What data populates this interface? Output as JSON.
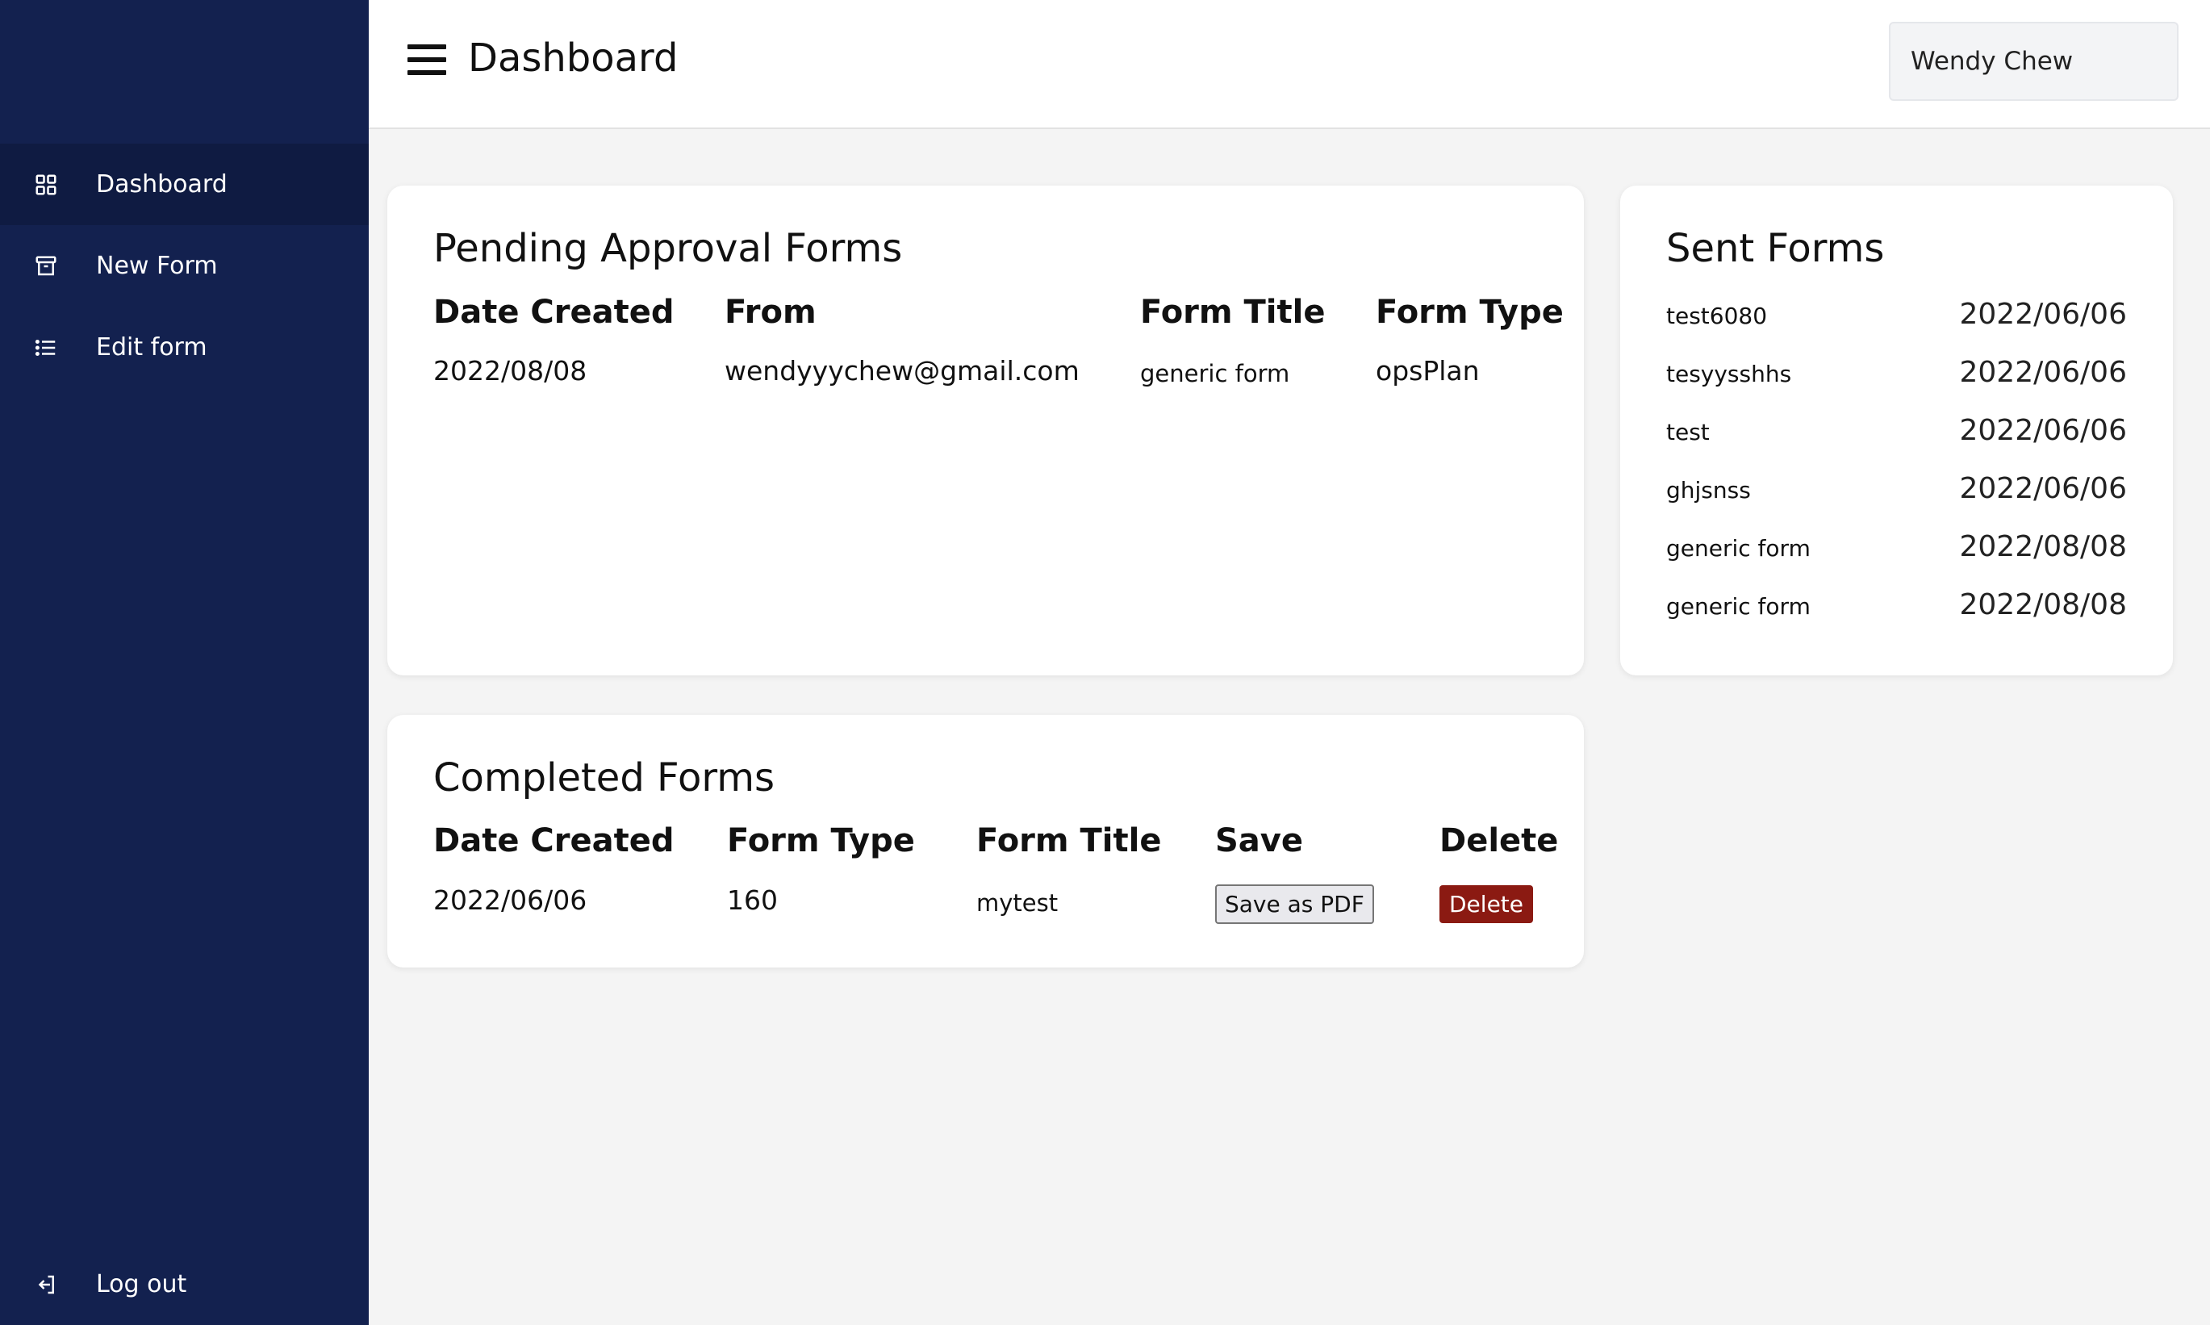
{
  "sidebar": {
    "items": [
      {
        "label": "Dashboard",
        "icon": "grid-icon"
      },
      {
        "label": "New Form",
        "icon": "archive-icon"
      },
      {
        "label": "Edit form",
        "icon": "list-icon"
      }
    ],
    "logout": {
      "label": "Log out",
      "icon": "logout-icon"
    }
  },
  "header": {
    "title": "Dashboard",
    "user": "Wendy Chew"
  },
  "pending": {
    "title": "Pending Approval Forms",
    "columns": [
      "Date Created",
      "From",
      "Form Title",
      "Form Type"
    ],
    "rows": [
      {
        "date": "2022/08/08",
        "from": "wendyyychew@gmail.com",
        "title": "generic form",
        "type": "opsPlan"
      }
    ]
  },
  "sent": {
    "title": "Sent Forms",
    "rows": [
      {
        "title": "test6080",
        "date": "2022/06/06"
      },
      {
        "title": "tesyysshhs",
        "date": "2022/06/06"
      },
      {
        "title": "test",
        "date": "2022/06/06"
      },
      {
        "title": "ghjsnss",
        "date": "2022/06/06"
      },
      {
        "title": "generic form",
        "date": "2022/08/08"
      },
      {
        "title": "generic form",
        "date": "2022/08/08"
      }
    ]
  },
  "completed": {
    "title": "Completed Forms",
    "columns": [
      "Date Created",
      "Form Type",
      "Form Title",
      "Save",
      "Delete"
    ],
    "rows": [
      {
        "date": "2022/06/06",
        "type": "160",
        "title": "mytest",
        "save_label": "Save as PDF",
        "delete_label": "Delete"
      }
    ]
  },
  "colors": {
    "sidebar": "#13214f",
    "sidebar_active": "#0f1b42",
    "delete": "#8b1a12"
  }
}
